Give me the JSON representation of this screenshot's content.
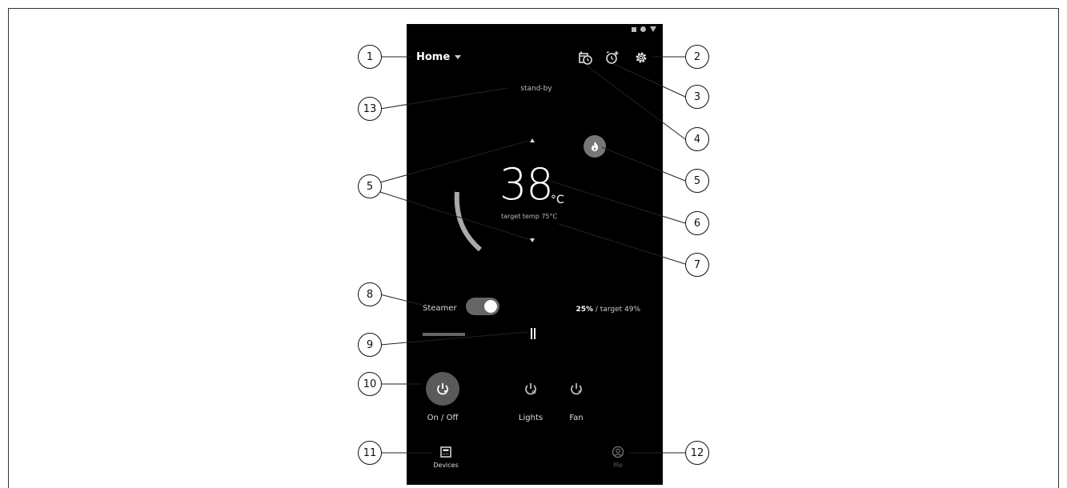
{
  "header": {
    "title": "Home"
  },
  "status": {
    "text": "stand-by"
  },
  "temperature": {
    "current": "38",
    "unit": "°C",
    "target_label": "target temp 75°C"
  },
  "steamer": {
    "label": "Steamer",
    "enabled": true,
    "humidity_current": "25%",
    "humidity_target": " / target 49%"
  },
  "controls": [
    {
      "label": "On / Off",
      "icon": "power-icon"
    },
    {
      "label": "Lights",
      "icon": "lights-icon"
    },
    {
      "label": "Fan",
      "icon": "fan-icon"
    }
  ],
  "bottom_nav": [
    {
      "label": "Devices",
      "icon": "devices-icon"
    },
    {
      "label": "Me",
      "icon": "user-icon"
    }
  ],
  "callouts": [
    "1",
    "2",
    "3",
    "4",
    "5",
    "5",
    "5",
    "6",
    "7",
    "8",
    "9",
    "10",
    "11",
    "12",
    "13"
  ],
  "colors": {
    "screen_bg": "#000000",
    "accent_gray": "#666666",
    "text": "#ffffff"
  }
}
